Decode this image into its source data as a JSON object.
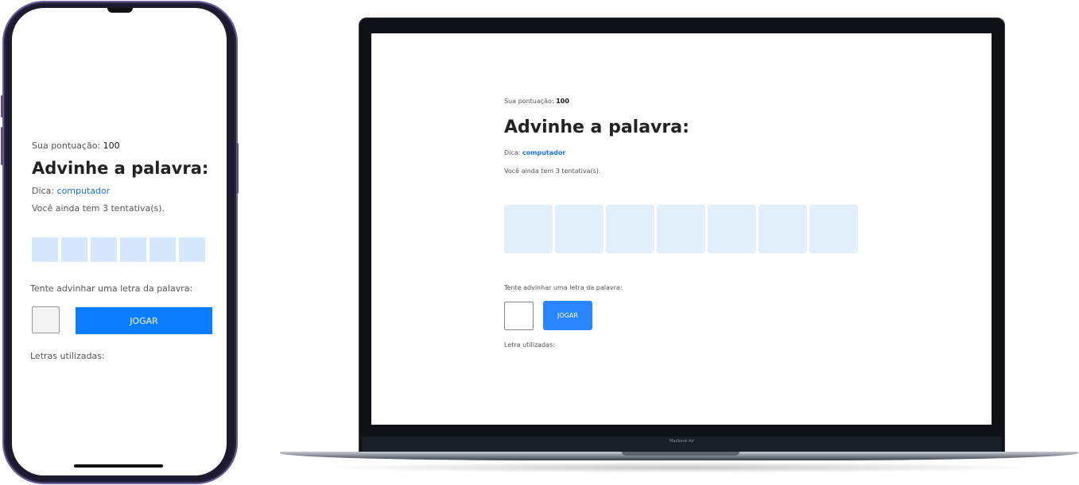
{
  "phone": {
    "score_label": "Sua pontuação:",
    "score_value": "100",
    "title": "Advinhe a palavra:",
    "hint_label": "Dica:",
    "hint_value": "computador",
    "tries_text": "Você ainda tem 3 tentativa(s).",
    "tile_count": 6,
    "guess_label": "Tente advinhar uma letra da palavra:",
    "play_button": "JOGAR",
    "used_letters_label": "Letras utilizadas:"
  },
  "laptop": {
    "score_label": "Sua pontuação:",
    "score_value": "100",
    "title": "Advinhe a palavra:",
    "hint_label": "Dica:",
    "hint_value": "computador",
    "tries_text": "Você ainda tem 3 tentativa(s).",
    "tile_count": 7,
    "guess_label": "Tente advinhar uma letra da palavra:",
    "play_button": "JOGAR",
    "used_letters_label": "Letra utilizadas:",
    "device_label": "Macbook Air"
  },
  "colors": {
    "accent": "#0a7cff",
    "hint": "#1a73e8",
    "tile_phone": "#d6e8fb",
    "tile_laptop": "#e3f0fc"
  }
}
